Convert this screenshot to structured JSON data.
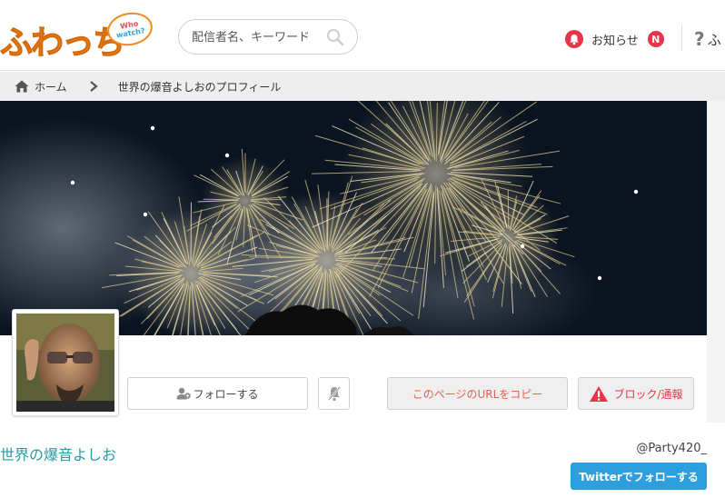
{
  "header": {
    "logo_text": "ふわっち",
    "logo_bubble_line1": "Who",
    "logo_bubble_line2": "watch?",
    "search_placeholder": "配信者名、キーワード",
    "notification_label": "お知らせ",
    "notification_badge": "N",
    "help_label": "ふ"
  },
  "breadcrumb": {
    "home_label": "ホーム",
    "current_label": "世界の爆音よしおのプロフィール"
  },
  "profile": {
    "follow_label": "フォローする",
    "copy_url_label": "このページのURLをコピー",
    "block_label": "ブロック/通報",
    "display_name": "世界の爆音よしお",
    "handle": "@Party420_",
    "twitter_follow_label": "Twitterでフォローする"
  },
  "icons": [
    "search-icon",
    "bell-icon",
    "help-icon",
    "home-icon",
    "chevron-right-icon",
    "follow-user-icon",
    "mute-bell-icon",
    "warning-icon"
  ],
  "colors": {
    "brand_orange": "#f08a1c",
    "accent_red": "#e8344a",
    "name_teal": "#2a9aa0",
    "twitter_blue": "#2d9fdf",
    "copy_text": "#e8604c"
  }
}
